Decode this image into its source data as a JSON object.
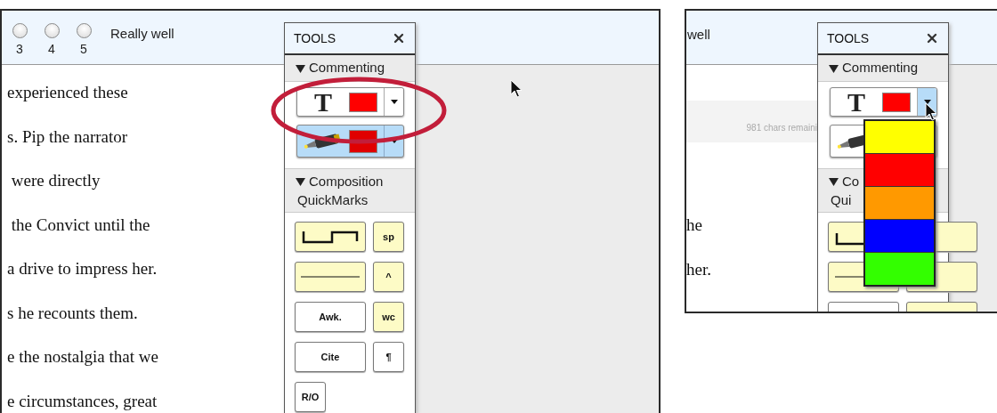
{
  "left_view": {
    "header": {
      "radios": [
        {
          "label": "3",
          "selected": false
        },
        {
          "label": "4",
          "selected": false
        },
        {
          "label": "5",
          "selected": false
        }
      ],
      "scale_label": "Really well"
    },
    "essay_lines": [
      "experienced these",
      "s. Pip the narrator",
      " were directly",
      " the Convict until the",
      "a drive to impress her.",
      "s he recounts them.",
      "e the nostalgia that we",
      "e circumstances, great"
    ],
    "tools": {
      "title": "TOOLS",
      "commenting": {
        "label": "Commenting",
        "expanded": true
      },
      "text_tool": {
        "glyph": "T",
        "color": "#ff0000",
        "dropdown_open": false
      },
      "highlighter": {
        "color": "#e00000",
        "selected": true
      },
      "composition": {
        "label_lines": [
          "Composition",
          "QuickMarks"
        ],
        "expanded": true
      },
      "quickmarks": [
        {
          "kind": "gap",
          "highlighted": true
        },
        {
          "kind": "text",
          "label": "sp",
          "highlighted": true
        },
        {
          "kind": "rule",
          "highlighted": true
        },
        {
          "kind": "text",
          "label": "^",
          "highlighted": true
        },
        {
          "kind": "text",
          "label": "Awk.",
          "highlighted": false
        },
        {
          "kind": "text",
          "label": "wc",
          "highlighted": true
        },
        {
          "kind": "text",
          "label": "Cite",
          "highlighted": false
        },
        {
          "kind": "text",
          "label": "¶",
          "highlighted": false
        },
        {
          "kind": "text",
          "label": "R/O",
          "highlighted": false
        }
      ]
    }
  },
  "right_view": {
    "header": {
      "scale_label": "well"
    },
    "char_count": "981 chars remaini",
    "essay_lines": [
      "he",
      "her."
    ],
    "tools": {
      "title": "TOOLS",
      "commenting": {
        "label": "Commenting",
        "expanded": true
      },
      "text_tool": {
        "glyph": "T",
        "color": "#ff0000",
        "dropdown_open": true
      },
      "highlighter": {
        "selected": false
      },
      "composition": {
        "label_lines": [
          "Co",
          "Qui"
        ],
        "expanded": true
      },
      "quickmarks": [
        {
          "kind": "gap_left",
          "highlighted": true
        },
        {
          "kind": "blank",
          "highlighted": true
        },
        {
          "kind": "rule_left",
          "highlighted": true
        },
        {
          "kind": "blank",
          "highlighted": true
        },
        {
          "kind": "blank",
          "highlighted": false
        },
        {
          "kind": "blank",
          "highlighted": true
        }
      ],
      "color_menu": [
        {
          "color": "#ffff00"
        },
        {
          "color": "#ff0000"
        },
        {
          "color": "#ff9900"
        },
        {
          "color": "#0000ff"
        },
        {
          "color": "#33ff00"
        }
      ]
    }
  }
}
